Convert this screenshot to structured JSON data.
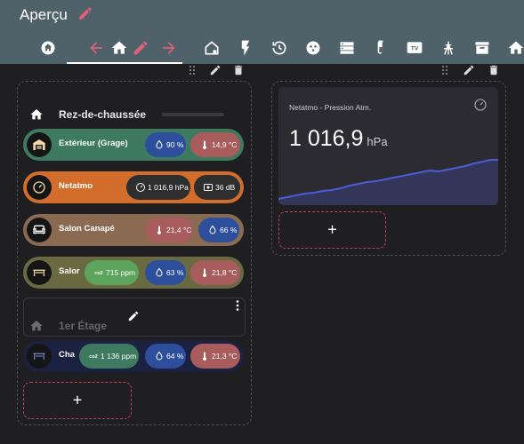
{
  "header": {
    "title": "Aperçu",
    "icons": [
      "home-icon",
      "arrow-left-icon",
      "home-edit-icon",
      "pencil-icon",
      "arrow-right-icon",
      "home-outline-icon",
      "flash-icon",
      "history-icon",
      "dashboard-icon",
      "server-icon",
      "test-tube-icon",
      "tv-icon",
      "antenna-icon",
      "archive-icon",
      "home-more-icon"
    ]
  },
  "left_column": {
    "room1": {
      "title": "Rez-de-chaussée",
      "rows": [
        {
          "label": "Extérieur (Grage)",
          "icon": "garage-icon",
          "color": "#3d7a5f",
          "chips": [
            {
              "icon": "water-drop-icon",
              "value": "90 %",
              "color": "#2d4f9b"
            },
            {
              "icon": "thermometer-icon",
              "value": "14,9 °C",
              "color": "#a85c5c"
            }
          ]
        },
        {
          "label": "Netatmo",
          "icon": "gauge-icon",
          "color": "#d36d2c",
          "chips": [
            {
              "icon": "gauge-icon",
              "value": "1 016,9 hPa",
              "color": "#2e2e2e"
            },
            {
              "icon": "sound-icon",
              "value": "36 dB",
              "color": "#2e2e2e"
            }
          ]
        },
        {
          "label": "Salon Canapé",
          "icon": "sofa-icon",
          "color": "#8a6b52",
          "chips": [
            {
              "icon": "thermometer-icon",
              "value": "21,4 °C",
              "color": "#a85c5c"
            },
            {
              "icon": "water-drop-icon",
              "value": "66 %",
              "color": "#2d4f9b"
            }
          ]
        },
        {
          "label": "Salor",
          "icon": "table-icon",
          "color": "#6a6a42",
          "chips": [
            {
              "icon": "co2-icon",
              "value": "715 ppm",
              "color": "#5ca35c"
            },
            {
              "icon": "water-drop-icon",
              "value": "63 %",
              "color": "#2d4f9b"
            },
            {
              "icon": "thermometer-icon",
              "value": "21,8 °C",
              "color": "#a85c5c"
            }
          ]
        }
      ]
    },
    "room2": {
      "title": "1er Étage",
      "rows": [
        {
          "label": "Cha",
          "icon": "table-icon",
          "color": "#1b2140",
          "chips": [
            {
              "icon": "co2-icon",
              "value": "1 136 ppm",
              "color": "#3d7a5f"
            },
            {
              "icon": "water-drop-icon",
              "value": "64 %",
              "color": "#2d4f9b"
            },
            {
              "icon": "thermometer-icon",
              "value": "21,3 °C",
              "color": "#a85c5c"
            }
          ]
        }
      ]
    },
    "add_label": "+"
  },
  "right_column": {
    "card": {
      "title": "Netatmo - Pression Atm.",
      "value": "1 016,9",
      "unit": "hPa",
      "line_color": "#4f5bd5",
      "fill_color": "#333559"
    },
    "add_label": "+"
  },
  "colors": {
    "topbar": "#4f6169",
    "background": "#1f1e21",
    "accent_add": "#c2415b"
  }
}
